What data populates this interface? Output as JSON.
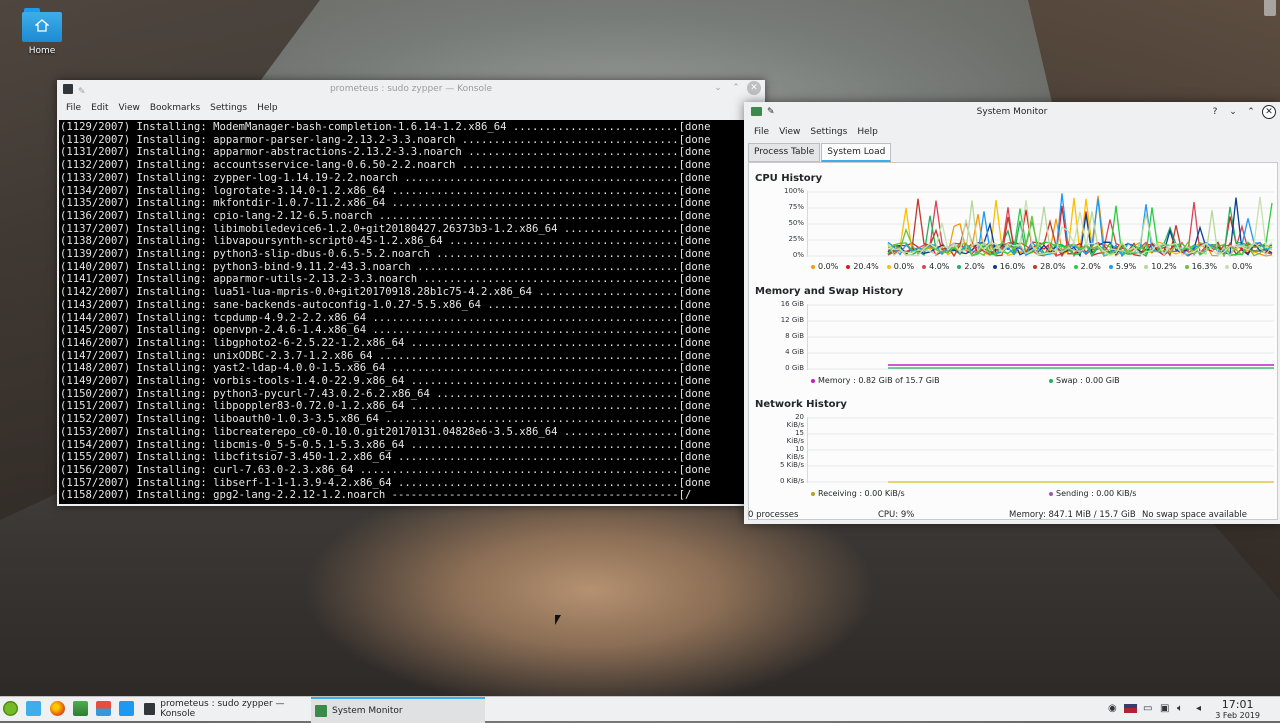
{
  "desktop": {
    "home_label": "Home"
  },
  "konsole": {
    "title": "prometeus : sudo zypper — Konsole",
    "menu": [
      "File",
      "Edit",
      "View",
      "Bookmarks",
      "Settings",
      "Help"
    ],
    "lines": [
      "(1129/2007) Installing: ModemManager-bash-completion-1.6.14-1.2.x86_64 ..........................[done",
      "(1130/2007) Installing: apparmor-parser-lang-2.13.2-3.3.noarch ..................................[done",
      "(1131/2007) Installing: apparmor-abstractions-2.13.2-3.3.noarch .................................[done",
      "(1132/2007) Installing: accountsservice-lang-0.6.50-2.2.noarch ..................................[done",
      "(1133/2007) Installing: zypper-log-1.14.19-2.2.noarch ...........................................[done",
      "(1134/2007) Installing: logrotate-3.14.0-1.2.x86_64 .............................................[done",
      "(1135/2007) Installing: mkfontdir-1.0.7-11.2.x86_64 .............................................[done",
      "(1136/2007) Installing: cpio-lang-2.12-6.5.noarch ...............................................[done",
      "(1137/2007) Installing: libimobiledevice6-1.2.0+git20180427.26373b3-1.2.x86_64 ..................[done",
      "(1138/2007) Installing: libvapoursynth-script0-45-1.2.x86_64 ....................................[done",
      "(1139/2007) Installing: python3-slip-dbus-0.6.5-5.2.noarch ......................................[done",
      "(1140/2007) Installing: python3-bind-9.11.2-43.3.noarch .........................................[done",
      "(1141/2007) Installing: apparmor-utils-2.13.2-3.3.noarch ........................................[done",
      "(1142/2007) Installing: lua51-lua-mpris-0.0+git20170918.28b1c75-4.2.x86_64 ......................[done",
      "(1143/2007) Installing: sane-backends-autoconfig-1.0.27-5.5.x86_64 ..............................[done",
      "(1144/2007) Installing: tcpdump-4.9.2-2.2.x86_64 ................................................[done",
      "(1145/2007) Installing: openvpn-2.4.6-1.4.x86_64 ................................................[done",
      "(1146/2007) Installing: libgphoto2-6-2.5.22-1.2.x86_64 ..........................................[done",
      "(1147/2007) Installing: unixODBC-2.3.7-1.2.x86_64 ...............................................[done",
      "(1148/2007) Installing: yast2-ldap-4.0.0-1.5.x86_64 .............................................[done",
      "(1149/2007) Installing: vorbis-tools-1.4.0-22.9.x86_64 ..........................................[done",
      "(1150/2007) Installing: python3-pycurl-7.43.0.2-6.2.x86_64 ......................................[done",
      "(1151/2007) Installing: libpoppler83-0.72.0-1.2.x86_64 ..........................................[done",
      "(1152/2007) Installing: liboauth0-1.0.3-3.5.x86_64 ..............................................[done",
      "(1153/2007) Installing: libcreaterepo_c0-0.10.0.git20170131.04828e6-3.5.x86_64 ..................[done",
      "(1154/2007) Installing: libcmis-0_5-5-0.5.1-5.3.x86_64 ..........................................[done",
      "(1155/2007) Installing: libcfitsio7-3.450-1.2.x86_64 ............................................[done",
      "(1156/2007) Installing: curl-7.63.0-2.3.x86_64 ..................................................[done",
      "(1157/2007) Installing: libserf-1-1-1.3.9-4.2.x86_64 ............................................[done",
      "(1158/2007) Installing: gpg2-lang-2.2.12-1.2.noarch ---------------------------------------------[/"
    ]
  },
  "sysmon": {
    "title": "System Monitor",
    "menu": [
      "File",
      "View",
      "Settings",
      "Help"
    ],
    "tabs": [
      "Process Table",
      "System Load"
    ],
    "cpu": {
      "title": "CPU History",
      "ticks": [
        "100%",
        "75%",
        "50%",
        "25%",
        "0%"
      ],
      "legend": [
        {
          "label": "0.0%",
          "color": "#f39c12"
        },
        {
          "label": "20.4%",
          "color": "#e31a1c"
        },
        {
          "label": "0.0%",
          "color": "#fdbf00"
        },
        {
          "label": "4.0%",
          "color": "#da4453"
        },
        {
          "label": "2.0%",
          "color": "#27ae60"
        },
        {
          "label": "16.0%",
          "color": "#0b3d91"
        },
        {
          "label": "28.0%",
          "color": "#c0392b"
        },
        {
          "label": "2.0%",
          "color": "#2ecc40"
        },
        {
          "label": "5.9%",
          "color": "#1d99f3"
        },
        {
          "label": "10.2%",
          "color": "#b7d79a"
        },
        {
          "label": "16.3%",
          "color": "#6fbf40"
        },
        {
          "label": "0.0%",
          "color": "#c8e0b0"
        }
      ]
    },
    "memory": {
      "title": "Memory and Swap History",
      "ticks": [
        "16 GiB",
        "12 GiB",
        "8 GiB",
        "4 GiB",
        "0 GiB"
      ],
      "legend_memory": "Memory : 0.82 GiB of 15.7 GiB",
      "legend_swap": "Swap : 0.00 GiB",
      "memory_color": "#c020c0",
      "swap_color": "#27ae60"
    },
    "network": {
      "title": "Network History",
      "ticks": [
        "20 KiB/s",
        "15 KiB/s",
        "10 KiB/s",
        "5 KiB/s",
        "0 KiB/s"
      ],
      "legend_receiving": "Receiving : 0.00 KiB/s",
      "legend_sending": "Sending : 0.00 KiB/s",
      "receiving_color": "#b8a020",
      "sending_color": "#9b59b6"
    },
    "status": {
      "processes": "0 processes",
      "cpu": "CPU: 9%",
      "memory": "Memory: 847.1 MiB / 15.7 GiB",
      "swap": "No swap space available"
    }
  },
  "taskbar": {
    "tasks": [
      {
        "label": "prometeus : sudo zypper — Konsole"
      },
      {
        "label": "System Monitor"
      }
    ],
    "clock_time": "17:01",
    "clock_date": "3 Feb 2019"
  }
}
